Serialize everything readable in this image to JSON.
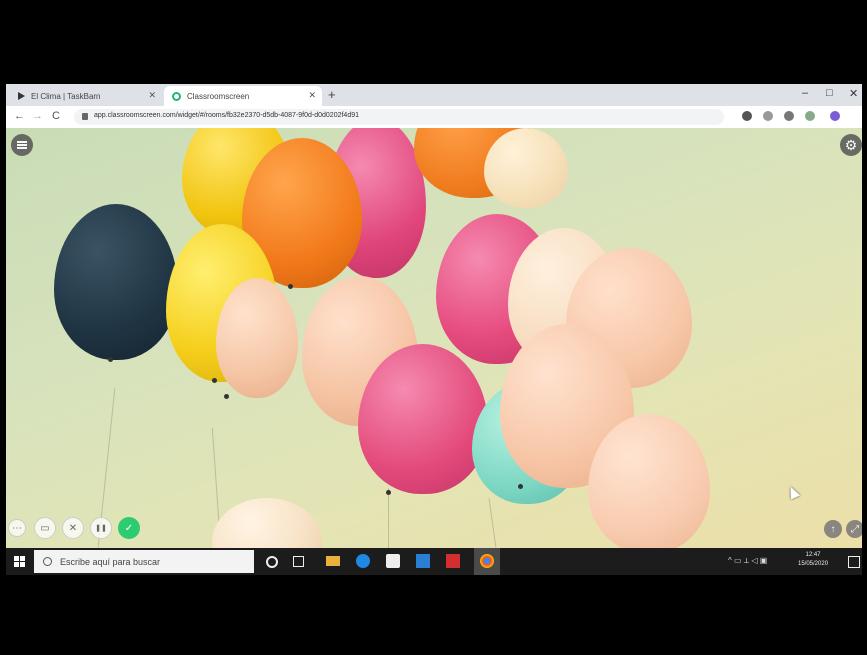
{
  "browser": {
    "tabs": [
      {
        "label": "El Clima | TaskBarn",
        "icon": "play-icon",
        "active": false
      },
      {
        "label": "Classroomscreen",
        "icon": "classroomscreen-icon",
        "active": true
      }
    ],
    "new_tab": "+",
    "window_controls": [
      "–",
      "□",
      "✕"
    ],
    "nav": {
      "back": "←",
      "forward": "→",
      "reload": "C"
    },
    "url": "app.classroomscreen.com/widget/#/rooms/fb32e2370-d5db-4087-9f0d-d0d0202f4d91"
  },
  "content": {
    "menu_icon": "hamburger-menu-icon",
    "settings_icon": "gear-icon",
    "settings_glyph": "⚙",
    "controls": [
      {
        "glyph": "⋯",
        "name": "more-button"
      },
      {
        "glyph": "▭",
        "name": "widgets-button"
      },
      {
        "glyph": "✕",
        "name": "close-button"
      },
      {
        "glyph": "❚❚",
        "name": "pause-button"
      },
      {
        "glyph": "✓",
        "name": "confirm-button"
      }
    ],
    "corner": [
      {
        "glyph": "↑",
        "name": "upload-button"
      },
      {
        "glyph": "⤢",
        "name": "fullscreen-button"
      }
    ]
  },
  "taskbar": {
    "search_placeholder": "Escribe aquí para buscar",
    "tray_icons": "^ ▭ ⟂ ◁ ▣",
    "time": "12:47",
    "date": "15/05/2020"
  }
}
